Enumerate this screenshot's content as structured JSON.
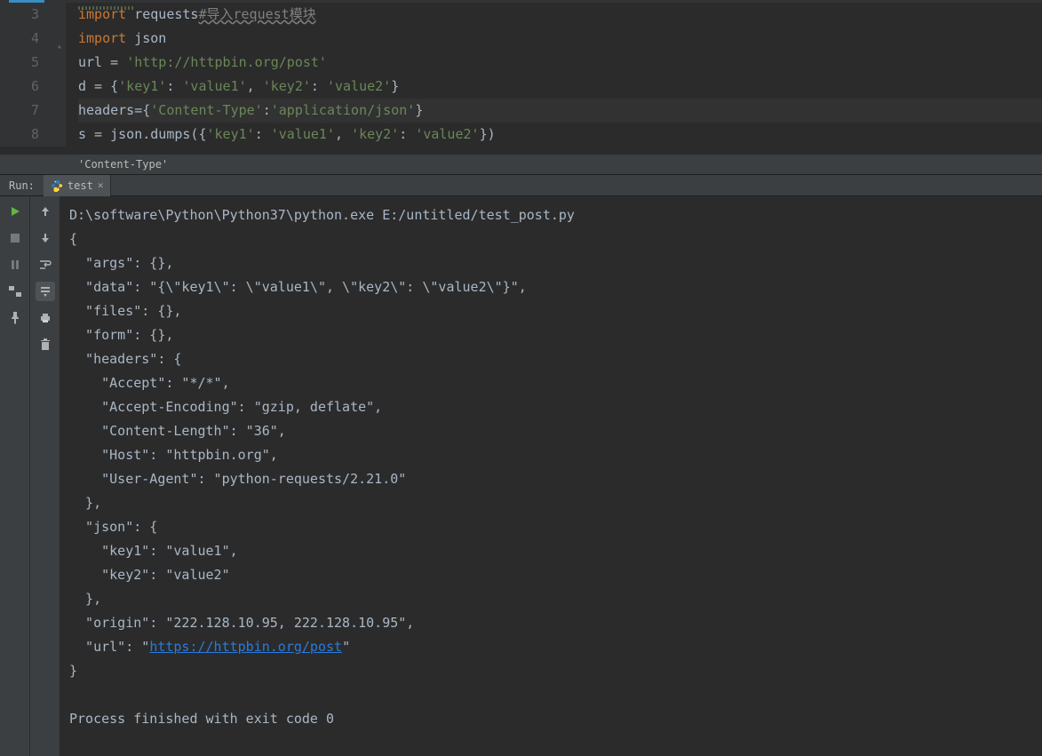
{
  "editor": {
    "line_numbers": [
      "3",
      "4",
      "5",
      "6",
      "7",
      "8"
    ],
    "lines": {
      "l3": {
        "kw": "import",
        "mod": " requests",
        "cmt": "#导入request模块"
      },
      "l4": {
        "kw": "import",
        "mod": " json"
      },
      "l5": {
        "var": "url = ",
        "str": "'http://httpbin.org/post'"
      },
      "l6": {
        "a": "d = {",
        "k1": "'key1'",
        "c1": ": ",
        "v1": "'value1'",
        "m": ", ",
        "k2": "'key2'",
        "c2": ": ",
        "v2": "'value2'",
        "z": "}"
      },
      "l7": {
        "a": "headers={",
        "k": "'Content-Type'",
        "c": ":",
        "v": "'application/json'",
        "z": "}"
      },
      "l8": {
        "a": "s = json.dumps({",
        "k1": "'key1'",
        "c1": ": ",
        "v1": "'value1'",
        "m": ", ",
        "k2": "'key2'",
        "c2": ": ",
        "v2": "'value2'",
        "z": "})"
      }
    }
  },
  "hint": "'Content-Type'",
  "run_tab": {
    "label": "Run:",
    "name": "test"
  },
  "console_lines": [
    "D:\\software\\Python\\Python37\\python.exe E:/untitled/test_post.py",
    "{",
    "  \"args\": {},",
    "  \"data\": \"{\\\"key1\\\": \\\"value1\\\", \\\"key2\\\": \\\"value2\\\"}\",",
    "  \"files\": {},",
    "  \"form\": {},",
    "  \"headers\": {",
    "    \"Accept\": \"*/*\",",
    "    \"Accept-Encoding\": \"gzip, deflate\",",
    "    \"Content-Length\": \"36\",",
    "    \"Host\": \"httpbin.org\",",
    "    \"User-Agent\": \"python-requests/2.21.0\"",
    "  },",
    "  \"json\": {",
    "    \"key1\": \"value1\",",
    "    \"key2\": \"value2\"",
    "  },",
    "  \"origin\": \"222.128.10.95, 222.128.10.95\",",
    "  \"url\": \"",
    "\""
  ],
  "url_link": "https://httpbin.org/post",
  "exit_line": "Process finished with exit code 0"
}
